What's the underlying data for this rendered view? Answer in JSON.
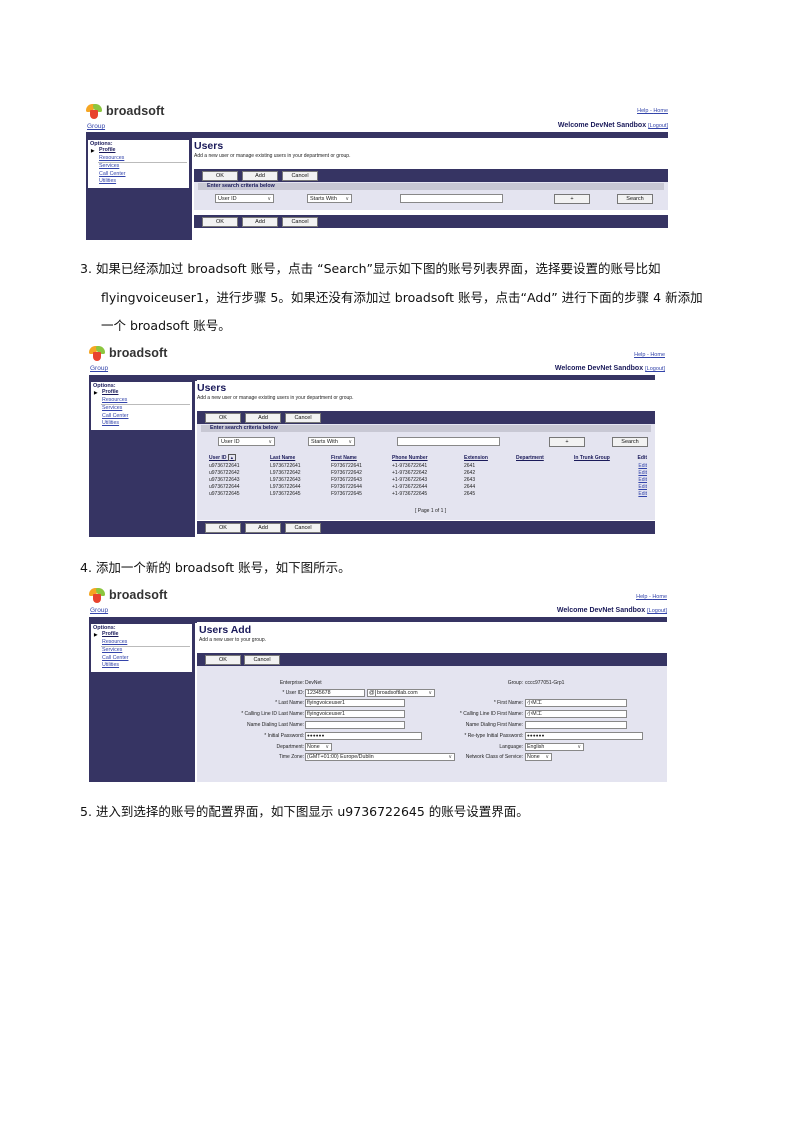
{
  "paragraphs": {
    "p3_line1": "3.  如果已经添加过 broadsoft 账号，点击 “Search”显示如下图的账号列表界面，选择要设置的账号比如",
    "p3_line2": "flyingvoiceuser1，进行步骤 5。如果还没有添加过 broadsoft 账号，点击“Add” 进行下面的步骤 4 新添加",
    "p3_line3": "一个 broadsoft 账号。",
    "p4": "4.  添加一个新的 broadsoft 账号，如下图所示。",
    "p5": "5.  进入到选择的账号的配置界面，如下图显示 u9736722645 的账号设置界面。"
  },
  "common": {
    "logo_text": "broadsoft",
    "help_link": "Help",
    "link_sep": " - ",
    "home_link": "Home",
    "group_link": "Group",
    "welcome": "Welcome DevNet Sandbox",
    "logout": "[Logout]",
    "options_title": "Options:",
    "options": [
      "Profile",
      "Resources",
      "Services",
      "Call Center",
      "Utilities"
    ],
    "ok": "OK",
    "add": "Add",
    "cancel": "Cancel",
    "search": "Search",
    "plus": "+",
    "criteria_title": "Enter search criteria below",
    "field_select": "User ID",
    "mode_select": "Starts With"
  },
  "screen1": {
    "title": "Users",
    "subtitle": "Add a new user or manage existing users in your department or group."
  },
  "screen2": {
    "title": "Users",
    "subtitle": "Add a new user or manage existing users in your department or group.",
    "columns": [
      "User ID",
      "Last Name",
      "First Name",
      "Phone Number",
      "Extension",
      "Department",
      "In Trunk Group",
      "Edit"
    ],
    "rows": [
      [
        "u9736722641",
        "L9736722641",
        "F9736722641",
        "+1-9736722641",
        "2641",
        "",
        "",
        "Edit"
      ],
      [
        "u9736722642",
        "L9736722642",
        "F9736722642",
        "+1-9736722642",
        "2642",
        "",
        "",
        "Edit"
      ],
      [
        "u9736722643",
        "L9736722643",
        "F9736722643",
        "+1-9736722643",
        "2643",
        "",
        "",
        "Edit"
      ],
      [
        "u9736722644",
        "L9736722644",
        "F9736722644",
        "+1-9736722644",
        "2644",
        "",
        "",
        "Edit"
      ],
      [
        "u9736722645",
        "L9736722645",
        "F9736722645",
        "+1-9736722645",
        "2645",
        "",
        "",
        "Edit"
      ]
    ],
    "page_of": "[ Page 1 of 1 ]"
  },
  "screen3": {
    "title": "Users Add",
    "subtitle": "Add a new user to your group.",
    "enterprise_label": "Enterprise:",
    "enterprise_value": "DevNet",
    "group_label": "Group:",
    "group_value": "cccc977051-Grp1",
    "userid_label": "* User ID:",
    "userid_value": "12345678",
    "at": "@",
    "domain_value": "broadsoftlab.com",
    "lastname_label": "* Last Name:",
    "lastname_value": "flyingvoiceuser1",
    "firstname_label": "* First Name:",
    "firstname_value": "小M工",
    "cl_lastname_label": "* Calling Line ID Last Name:",
    "cl_lastname_value": "flyingvoiceuser1",
    "cl_firstname_label": "* Calling Line ID First Name:",
    "cl_firstname_value": "小M工",
    "nd_lastname_label": "Name Dialing Last Name:",
    "nd_firstname_label": "Name Dialing First Name:",
    "password_label": "* Initial Password:",
    "password_value": "●●●●●●",
    "retype_label": "* Re-type Initial Password:",
    "retype_value": "●●●●●●",
    "department_label": "Department:",
    "department_value": "None",
    "language_label": "Language:",
    "language_value": "English",
    "timezone_label": "Time Zone:",
    "timezone_value": "(GMT+01:00) Europe/Dublin",
    "ncos_label": "Network Class of Service:",
    "ncos_value": "None"
  }
}
